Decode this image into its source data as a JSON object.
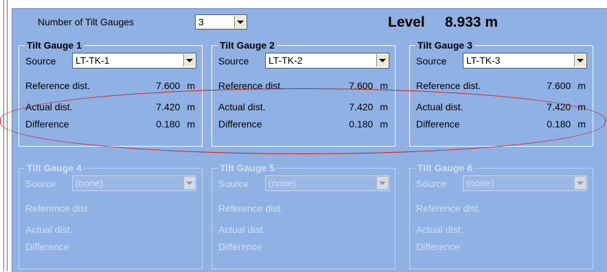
{
  "top": {
    "count_label": "Number of Tilt Gauges",
    "count_value": "3",
    "level_label": "Level",
    "level_value": "8.933 m"
  },
  "gauges": [
    {
      "title": "Tilt Gauge 1",
      "source_label": "Source",
      "source": "LT-TK-1",
      "ref_label": "Reference dist.",
      "ref_value": "7.600",
      "ref_unit": "m",
      "act_label": "Actual dist.",
      "act_value": "7.420",
      "act_unit": "m",
      "diff_label": "Difference",
      "diff_value": "0.180",
      "diff_unit": "m"
    },
    {
      "title": "Tilt Gauge 2",
      "source_label": "Source",
      "source": "LT-TK-2",
      "ref_label": "Reference dist.",
      "ref_value": "7.600",
      "ref_unit": "m",
      "act_label": "Actual dist.",
      "act_value": "7.420",
      "act_unit": "m",
      "diff_label": "Difference",
      "diff_value": "0.180",
      "diff_unit": "m"
    },
    {
      "title": "Tilt Gauge 3",
      "source_label": "Source",
      "source": "LT-TK-3",
      "ref_label": "Reference dist.",
      "ref_value": "7.600",
      "ref_unit": "m",
      "act_label": "Actual dist.",
      "act_value": "7.420",
      "act_unit": "m",
      "diff_label": "Difference",
      "diff_value": "0.180",
      "diff_unit": "m"
    },
    {
      "title": "Tilt Gauge 4",
      "source_label": "Source",
      "source": "(none)",
      "ref_label": "Reference dist.",
      "act_label": "Actual dist.",
      "diff_label": "Difference"
    },
    {
      "title": "Tilt Gauge 5",
      "source_label": "Source",
      "source": "(none)",
      "ref_label": "Reference dist.",
      "act_label": "Actual dist.",
      "diff_label": "Difference"
    },
    {
      "title": "Tilt Gauge 6",
      "source_label": "Source",
      "source": "(none)",
      "ref_label": "Reference dist.",
      "act_label": "Actual dist.",
      "diff_label": "Difference"
    }
  ],
  "colors": {
    "panel_bg": "#8fb1e3",
    "highlight": "#d01818",
    "disabled_text": "#d2dff2"
  }
}
